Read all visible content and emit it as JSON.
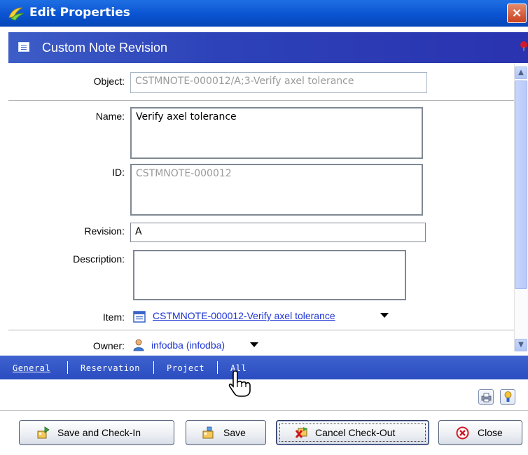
{
  "window": {
    "title": "Edit Properties",
    "close_glyph": "×"
  },
  "header": {
    "title": "Custom Note Revision"
  },
  "form": {
    "object": {
      "label": "Object:",
      "value": "CSTMNOTE-000012/A;3-Verify axel tolerance"
    },
    "name": {
      "label": "Name:",
      "value": "Verify axel tolerance"
    },
    "id": {
      "label": "ID:",
      "value": "CSTMNOTE-000012"
    },
    "revision": {
      "label": "Revision:",
      "value": "A"
    },
    "description": {
      "label": "Description:",
      "value": ""
    },
    "item": {
      "label": "Item:",
      "value": "CSTMNOTE-000012-Verify axel tolerance"
    },
    "owner": {
      "label": "Owner:",
      "value": "infodba (infodba)"
    }
  },
  "tabs": [
    {
      "label": "General"
    },
    {
      "label": "Reservation"
    },
    {
      "label": "Project"
    },
    {
      "label": "All"
    }
  ],
  "buttons": {
    "save_checkin": "Save and Check-In",
    "save": "Save",
    "cancel_checkout": "Cancel Check-Out",
    "close": "Close"
  },
  "colors": {
    "titlebar": "#0a53d1",
    "header_band": "#2d42b8",
    "tab_band": "#2a4cc0",
    "link": "#1d34d6"
  },
  "icons": [
    "app-icon",
    "close-icon",
    "note-icon",
    "pin-icon",
    "item-icon",
    "user-icon",
    "dropdown-icon",
    "print-icon",
    "help-icon",
    "hand-cursor-icon",
    "checkin-icon",
    "save-icon",
    "cancel-checkout-icon",
    "close-circle-icon"
  ]
}
